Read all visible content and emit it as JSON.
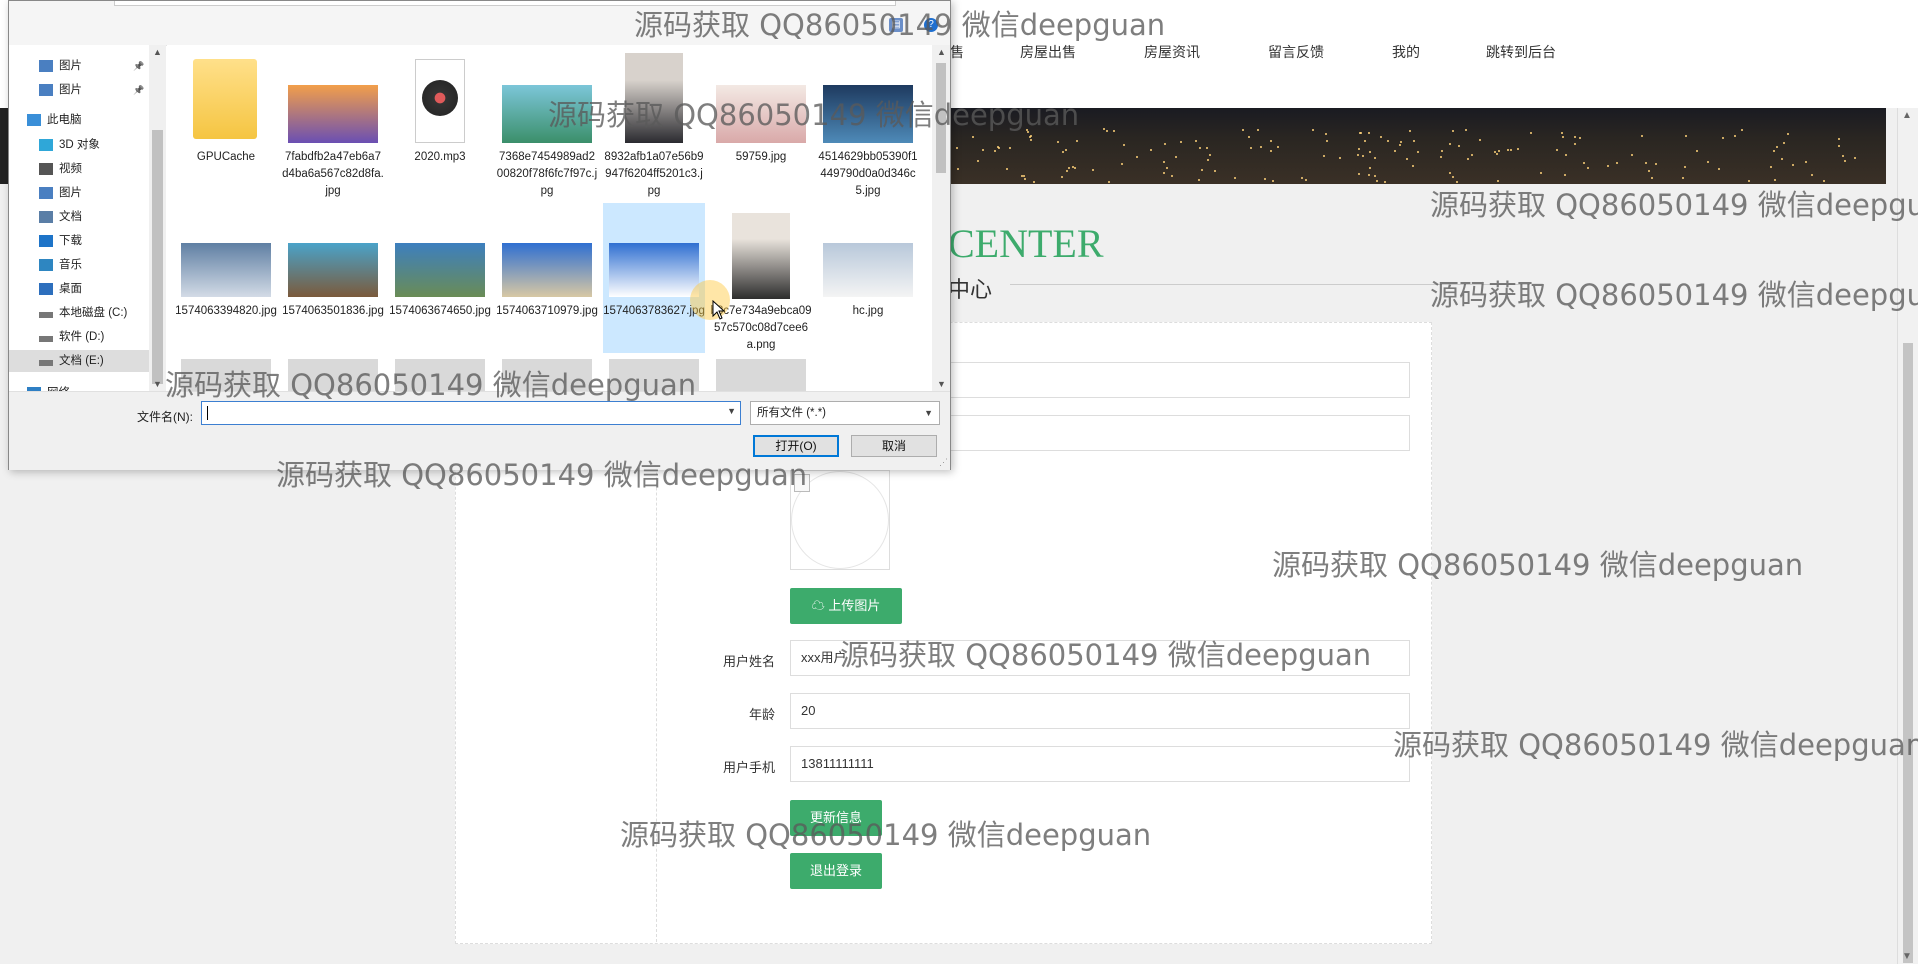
{
  "nav": {
    "items": [
      "房屋出售",
      "房屋资讯",
      "留言反馈",
      "我的",
      "跳转到后台"
    ],
    "partial_item": "售"
  },
  "section": {
    "title": "CENTER",
    "subtitle": "中心"
  },
  "form": {
    "upload_button": "上传图片",
    "labels": {
      "username": "用户姓名",
      "age": "年龄",
      "phone": "用户手机"
    },
    "values": {
      "username": "xxx用户",
      "age": "20",
      "phone": "13811111111"
    },
    "update_button": "更新信息",
    "logout_button": "退出登录"
  },
  "dialog": {
    "tree": [
      {
        "label": "图片",
        "icon": "pictures-icon",
        "pinned": true
      },
      {
        "label": "图片",
        "icon": "pictures-icon",
        "pinned": true
      },
      {
        "label": "此电脑",
        "icon": "computer-icon"
      },
      {
        "label": "3D 对象",
        "icon": "3d-objects-icon"
      },
      {
        "label": "视频",
        "icon": "video-icon"
      },
      {
        "label": "图片",
        "icon": "pictures-icon"
      },
      {
        "label": "文档",
        "icon": "documents-icon"
      },
      {
        "label": "下载",
        "icon": "download-icon"
      },
      {
        "label": "音乐",
        "icon": "music-icon"
      },
      {
        "label": "桌面",
        "icon": "desktop-icon"
      },
      {
        "label": "本地磁盘 (C:)",
        "icon": "drive-icon"
      },
      {
        "label": "软件 (D:)",
        "icon": "drive-icon"
      },
      {
        "label": "文档 (E:)",
        "icon": "drive-icon",
        "selected": true
      },
      {
        "label": "网络",
        "icon": "network-icon"
      }
    ],
    "files_row1": [
      {
        "name": "GPUCache",
        "kind": "folder"
      },
      {
        "name": "7fabdfb2a47eb6a7d4ba6a567c82d8fa.jpg",
        "kind": "image"
      },
      {
        "name": "2020.mp3",
        "kind": "audio"
      },
      {
        "name": "7368e7454989ad200820f78f6fc7f97c.jpg",
        "kind": "image"
      },
      {
        "name": "8932afb1a07e56b9947f6204ff5201c3.jpg",
        "kind": "portrait"
      },
      {
        "name": "59759.jpg",
        "kind": "image"
      },
      {
        "name": "4514629bb05390f1449790d0a0d346c5.jpg",
        "kind": "image"
      }
    ],
    "files_row2": [
      {
        "name": "1574063394820.jpg",
        "kind": "image"
      },
      {
        "name": "1574063501836.jpg",
        "kind": "image"
      },
      {
        "name": "1574063674650.jpg",
        "kind": "image"
      },
      {
        "name": "1574063710979.jpg",
        "kind": "image"
      },
      {
        "name": "1574063783627.jpg",
        "kind": "image",
        "selected": true
      },
      {
        "name": "b8c7e734a9ebca0957c570c08d7cee6a.png",
        "kind": "portrait"
      },
      {
        "name": "hc.jpg",
        "kind": "image"
      }
    ],
    "filename_label": "文件名(N):",
    "filename_value": "",
    "filetype": "所有文件 (*.*)",
    "open_button": "打开(O)",
    "cancel_button": "取消"
  },
  "watermark": "源码获取 QQ86050149 微信deepguan",
  "colors": {
    "accent": "#3dab6c",
    "selection": "#cce8ff",
    "focus": "#0078d7"
  }
}
